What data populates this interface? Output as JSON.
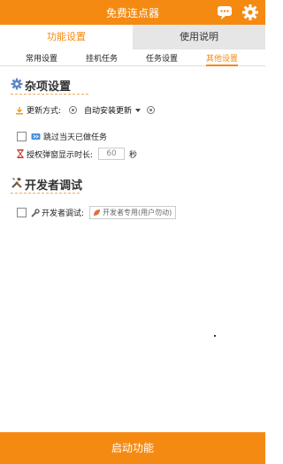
{
  "window": {
    "title": "免费连点器"
  },
  "main_tabs": [
    {
      "label": "功能设置",
      "active": true
    },
    {
      "label": "使用说明",
      "active": false
    }
  ],
  "sub_tabs": [
    {
      "label": "常用设置"
    },
    {
      "label": "挂机任务"
    },
    {
      "label": "任务设置"
    },
    {
      "label": "其他设置",
      "active": true
    }
  ],
  "misc": {
    "title": "杂项设置",
    "update_label": "更新方式:",
    "update_value": "自动安装更新",
    "skip_label": "跳过当天已做任务",
    "auth_label": "授权弹窗显示时长:",
    "auth_value": "60",
    "auth_unit": "秒"
  },
  "dev": {
    "title": "开发者调试",
    "label": "开发者调试:",
    "placeholder": "开发者专用(用户勿动)"
  },
  "footer": {
    "start_label": "启动功能"
  },
  "colors": {
    "accent": "#f58a12"
  }
}
